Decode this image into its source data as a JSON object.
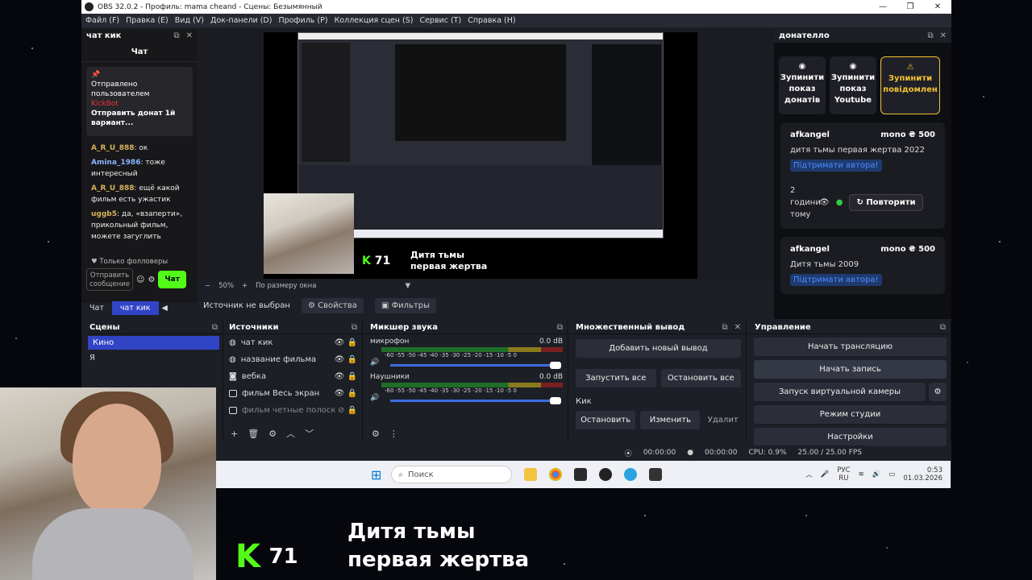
{
  "window": {
    "title": "OBS 32.0.2 - Профиль: mama cheand - Сцены: Безымянный",
    "controls": [
      "—",
      "❐",
      "✕"
    ]
  },
  "menu": [
    "Файл (F)",
    "Правка (E)",
    "Вид (V)",
    "Док-панели (D)",
    "Профиль (P)",
    "Коллекция сцен (S)",
    "Сервис (T)",
    "Справка (H)"
  ],
  "chat": {
    "dock_title": "чат кик",
    "title": "Чат",
    "pinned": {
      "line1": "Отправлено",
      "line2": "пользователем",
      "bot": "KickBot",
      "text": "Отправить донат 1й вариант..."
    },
    "messages": [
      {
        "user": "A_R_U_888",
        "text": ": ок",
        "color": "gold"
      },
      {
        "user": "Amina_1986",
        "text": ": тоже интересный",
        "color": "blue"
      },
      {
        "user": "A_R_U_888",
        "text": ": ещё какой фильм есть ужастик",
        "color": "gold"
      },
      {
        "user": "uggb5",
        "text": ": да, «взаперти», прикольный фильм, можете загуглить",
        "color": "gold"
      }
    ],
    "followers_only": "Только фолловеры",
    "input_placeholder": "Отправить сообщение",
    "send": "Чат",
    "tabs": [
      "Чат",
      "чат кик"
    ]
  },
  "preview": {
    "overlay_number": "71",
    "caption_line1": "Дитя тьмы",
    "caption_line2": "первая жертва",
    "zoom": "50%",
    "fit": "По размеру окна"
  },
  "source_bar": {
    "none_selected": "Источник не выбран",
    "properties": "Свойства",
    "filters": "Фильтры"
  },
  "donatello": {
    "dock_title": "донателло",
    "buttons": [
      "Зупинити показ донатів",
      "Зупинити показ Youtube",
      "Зупинити повідомлен"
    ],
    "cards": [
      {
        "user": "afkangel",
        "amount": "mono ₴ 500",
        "text": "дитя тьмы первая жертва 2022",
        "tag": "Підтримати автора!",
        "time": "2 години тому",
        "repeat": "Повторити"
      },
      {
        "user": "afkangel",
        "amount": "mono ₴ 500",
        "text": "Дитя тьмы 2009",
        "tag": "Підтримати автора!"
      }
    ]
  },
  "scenes": {
    "title": "Сцены",
    "items": [
      "Кино",
      "Я"
    ]
  },
  "sources": {
    "title": "Источники",
    "items": [
      "чат кик",
      "название фильма",
      "вебка",
      "фильм Весь экран",
      "фильм четные полоск"
    ]
  },
  "mixer": {
    "title": "Микшер звука",
    "channels": [
      {
        "name": "микрофон",
        "db": "0.0 dB"
      },
      {
        "name": "Наушники",
        "db": "0.0 dB"
      }
    ],
    "scale": "-60 -55 -50 -45 -40 -35 -30 -25 -20 -15 -10 -5 0"
  },
  "multi": {
    "title": "Множественный вывод",
    "add": "Добавить новый вывод",
    "start_all": "Запустить все",
    "stop_all": "Остановить все",
    "target": "Кик",
    "stop": "Остановить",
    "edit": "Изменить",
    "delete": "Удалит"
  },
  "controls": {
    "title": "Управление",
    "buttons": [
      "Начать трансляцию",
      "Начать запись",
      "Запуск виртуальной камеры",
      "Режим студии",
      "Настройки"
    ]
  },
  "status": {
    "stream_time": "00:00:00",
    "rec_time": "00:00:00",
    "cpu": "CPU: 0.9%",
    "fps": "25.00 / 25.00 FPS"
  },
  "taskbar": {
    "search": "Поиск",
    "lang1": "РУС",
    "lang2": "RU",
    "time": "0:53",
    "date": "01.03.2026"
  },
  "overlay": {
    "number": "71",
    "line1": "Дитя тьмы",
    "line2": "первая жертва"
  },
  "colors": {
    "kick_green": "#53fc18",
    "obs_blue": "#3144c5",
    "donatello_yellow": "#f1c232"
  }
}
